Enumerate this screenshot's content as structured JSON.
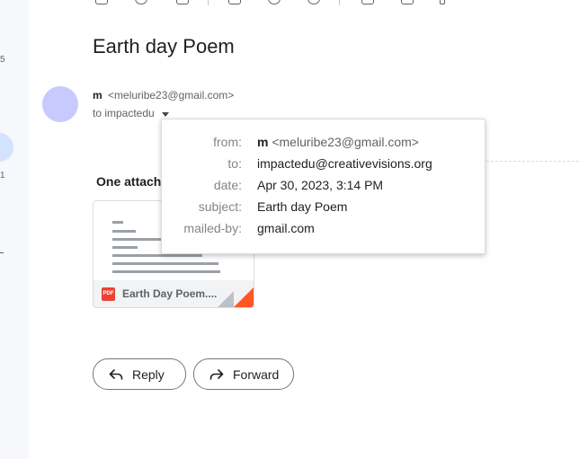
{
  "rail": {
    "num_top": "5",
    "num_mid": "1"
  },
  "message": {
    "subject": "Earth day Poem",
    "sender_name": "m",
    "sender_email": "<meluribe23@gmail.com>",
    "to_summary": "to impactedu"
  },
  "details": {
    "from_label": "from:",
    "from_name": "m",
    "from_email": "<meluribe23@gmail.com>",
    "to_label": "to:",
    "to_value": "impactedu@creativevisions.org",
    "date_label": "date:",
    "date_value": "Apr 30, 2023, 3:14 PM",
    "subject_label": "subject:",
    "subject_value": "Earth day Poem",
    "mailedby_label": "mailed-by:",
    "mailedby_value": "gmail.com"
  },
  "attachments": {
    "heading": "One attach",
    "file_name": "Earth Day Poem....",
    "file_type": "PDF"
  },
  "actions": {
    "reply_label": "Reply",
    "forward_label": "Forward"
  },
  "icons": [
    "reply-icon",
    "forward-icon",
    "pdf-icon",
    "chevron-down-icon"
  ]
}
